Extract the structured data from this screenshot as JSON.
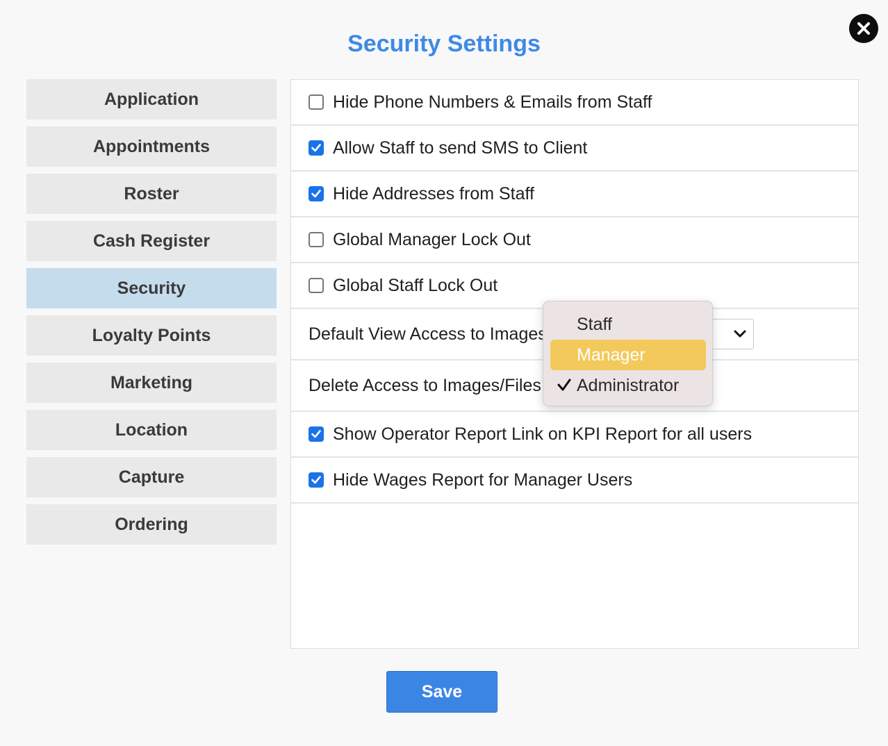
{
  "title": "Security Settings",
  "close_icon": "close-icon",
  "sidebar": {
    "items": [
      {
        "label": "Application",
        "active": false
      },
      {
        "label": "Appointments",
        "active": false
      },
      {
        "label": "Roster",
        "active": false
      },
      {
        "label": "Cash Register",
        "active": false
      },
      {
        "label": "Security",
        "active": true
      },
      {
        "label": "Loyalty Points",
        "active": false
      },
      {
        "label": "Marketing",
        "active": false
      },
      {
        "label": "Location",
        "active": false
      },
      {
        "label": "Capture",
        "active": false
      },
      {
        "label": "Ordering",
        "active": false
      }
    ]
  },
  "settings": {
    "hide_phone": {
      "label": "Hide Phone Numbers & Emails from Staff",
      "checked": false
    },
    "allow_sms": {
      "label": "Allow Staff to send SMS to Client",
      "checked": true
    },
    "hide_addresses": {
      "label": "Hide Addresses from Staff",
      "checked": true
    },
    "global_manager_lockout": {
      "label": "Global Manager Lock Out",
      "checked": false
    },
    "global_staff_lockout": {
      "label": "Global Staff Lock Out",
      "checked": false
    },
    "default_view_access": {
      "label": "Default View Access to Images/Files",
      "value": "Administrator"
    },
    "delete_access": {
      "label": "Delete Access to Images/Files"
    },
    "show_operator_report": {
      "label": "Show Operator Report Link on KPI Report for all users",
      "checked": true
    },
    "hide_wages_report": {
      "label": "Hide Wages Report for Manager Users",
      "checked": true
    }
  },
  "dropdown": {
    "options": [
      "Staff",
      "Manager",
      "Administrator"
    ],
    "highlighted": "Manager",
    "selected": "Administrator"
  },
  "save_label": "Save",
  "colors": {
    "accent": "#3d8ae6",
    "active_tab": "#c5dced",
    "checkbox": "#1a73e8",
    "highlight": "#f2c95a",
    "save_button": "#3b86e4"
  }
}
